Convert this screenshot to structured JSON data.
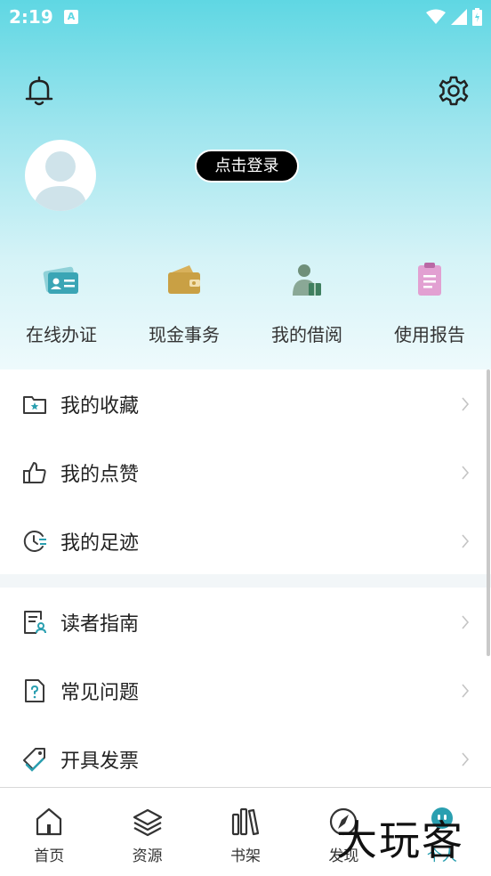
{
  "status_bar": {
    "time": "2:19",
    "app_badge": "A"
  },
  "profile": {
    "login_button": "点击登录"
  },
  "quick_actions": [
    {
      "label": "在线办证",
      "icon": "id-card-icon"
    },
    {
      "label": "现金事务",
      "icon": "wallet-icon"
    },
    {
      "label": "我的借阅",
      "icon": "reader-book-icon"
    },
    {
      "label": "使用报告",
      "icon": "clipboard-report-icon"
    }
  ],
  "menu_group_1": [
    {
      "label": "我的收藏",
      "icon": "folder-star-icon"
    },
    {
      "label": "我的点赞",
      "icon": "thumbs-up-icon"
    },
    {
      "label": "我的足迹",
      "icon": "clock-history-icon"
    }
  ],
  "menu_group_2": [
    {
      "label": "读者指南",
      "icon": "guide-document-icon"
    },
    {
      "label": "常见问题",
      "icon": "question-document-icon"
    },
    {
      "label": "开具发票",
      "icon": "invoice-tag-icon"
    }
  ],
  "tabs": [
    {
      "label": "首页",
      "icon": "home-icon"
    },
    {
      "label": "资源",
      "icon": "layers-icon"
    },
    {
      "label": "书架",
      "icon": "bookshelf-icon"
    },
    {
      "label": "发现",
      "icon": "compass-icon"
    },
    {
      "label": "个人",
      "icon": "profile-face-icon",
      "active": true
    }
  ],
  "watermark": "大玩客",
  "colors": {
    "accent": "#2a9fb0",
    "header_top": "#5fd7e3"
  }
}
